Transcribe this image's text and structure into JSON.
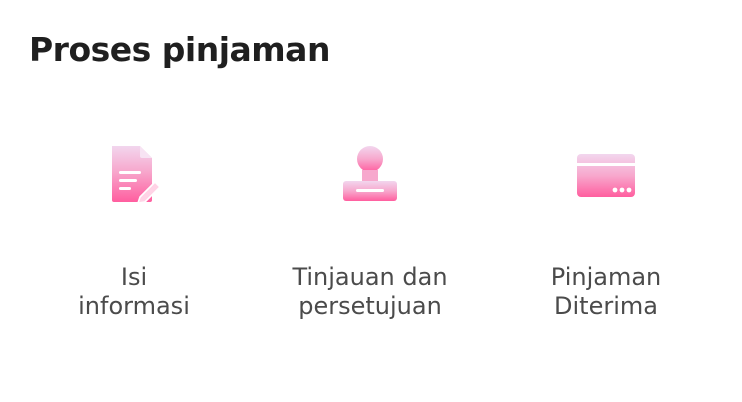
{
  "page": {
    "title": "Proses pinjaman"
  },
  "steps": [
    {
      "icon": "document-edit-icon",
      "label_line1": "Isi",
      "label_line2": "informasi"
    },
    {
      "icon": "stamp-icon",
      "label_line1": "Tinjauan dan",
      "label_line2": "persetujuan"
    },
    {
      "icon": "card-icon",
      "label_line1": "Pinjaman",
      "label_line2": "Diterima"
    }
  ],
  "colors": {
    "title": "#1f1f1f",
    "label": "#4b4b4b",
    "icon_gradient_top": "#f6d7ef",
    "icon_gradient_bottom": "#ff5c9e"
  }
}
